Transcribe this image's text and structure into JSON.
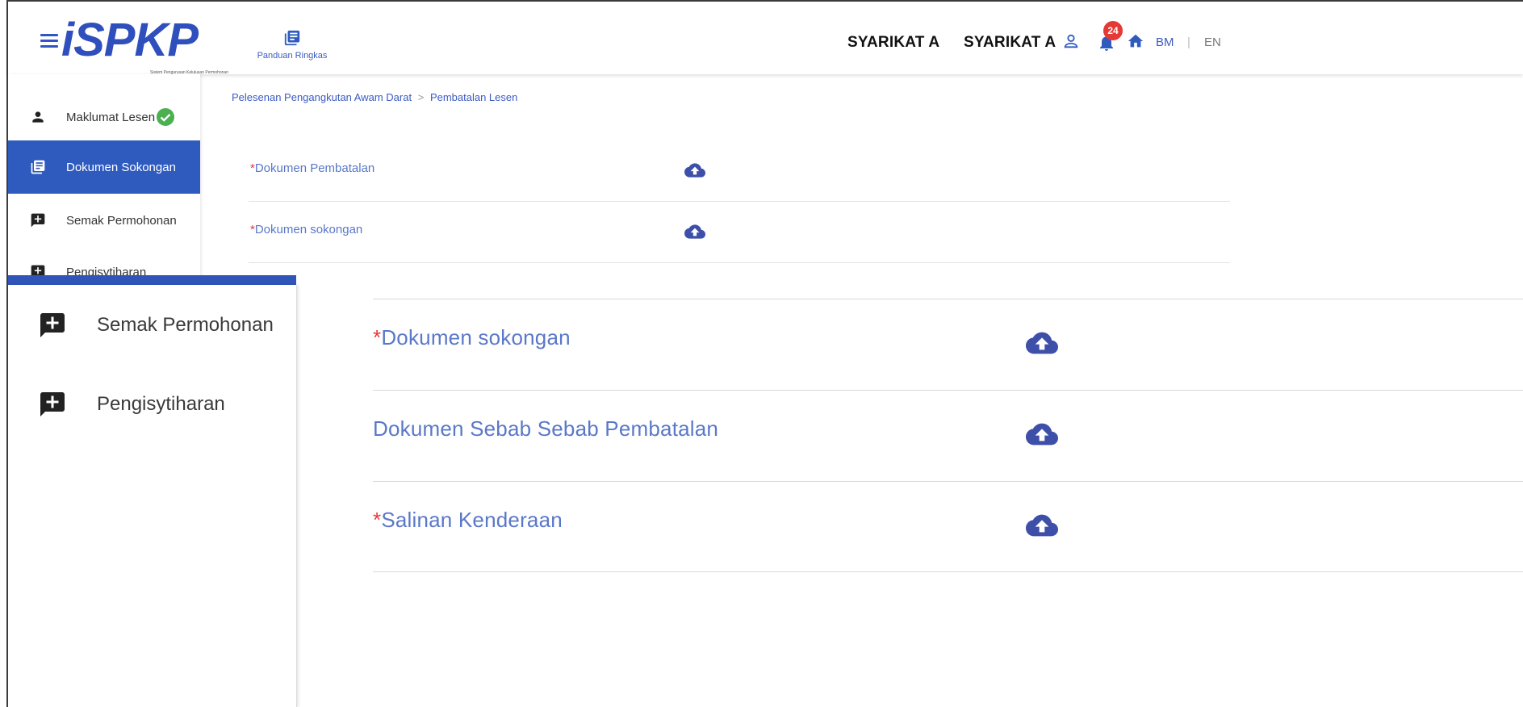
{
  "header": {
    "logo_text": "iSPKP",
    "logo_tagline": "Sistem Pengurusan Kelulusan Permohonan",
    "guide_label": "Panduan Ringkas",
    "company_1": "SYARIKAT A",
    "company_2": "SYARIKAT A",
    "notification_count": "24",
    "lang_bm": "BM",
    "lang_separator": "|",
    "lang_en": "EN"
  },
  "sidebar": {
    "items": [
      {
        "label": "Maklumat Lesen",
        "icon": "person-icon",
        "status": "complete"
      },
      {
        "label": "Dokumen Sokongan",
        "icon": "document-icon",
        "active": true
      },
      {
        "label": "Semak Permohonan",
        "icon": "chat-plus-icon"
      },
      {
        "label": "Pengisytiharan",
        "icon": "chat-plus-icon"
      }
    ]
  },
  "breadcrumb": {
    "parent": "Pelesenan Pengangkutan Awam Darat",
    "separator": ">",
    "current": "Pembatalan Lesen"
  },
  "documents_top": [
    {
      "required": "*",
      "label": "Dokumen Pembatalan"
    },
    {
      "required": "*",
      "label": "Dokumen sokongan"
    }
  ],
  "zoom_sidebar": {
    "items": [
      {
        "label": "Semak Permohonan",
        "icon": "chat-plus-icon"
      },
      {
        "label": "Pengisytiharan",
        "icon": "chat-plus-icon"
      }
    ]
  },
  "zoom_documents": [
    {
      "required": "*",
      "label": "Dokumen sokongan"
    },
    {
      "required": "",
      "label": "Dokumen Sebab Sebab Pembatalan"
    },
    {
      "required": "*",
      "label": "Salinan Kenderaan"
    }
  ],
  "colors": {
    "primary": "#2f5bbf",
    "link": "#5a78c8",
    "required": "#e53935",
    "upload_icon": "#3d4fa8",
    "success": "#4caf50"
  }
}
